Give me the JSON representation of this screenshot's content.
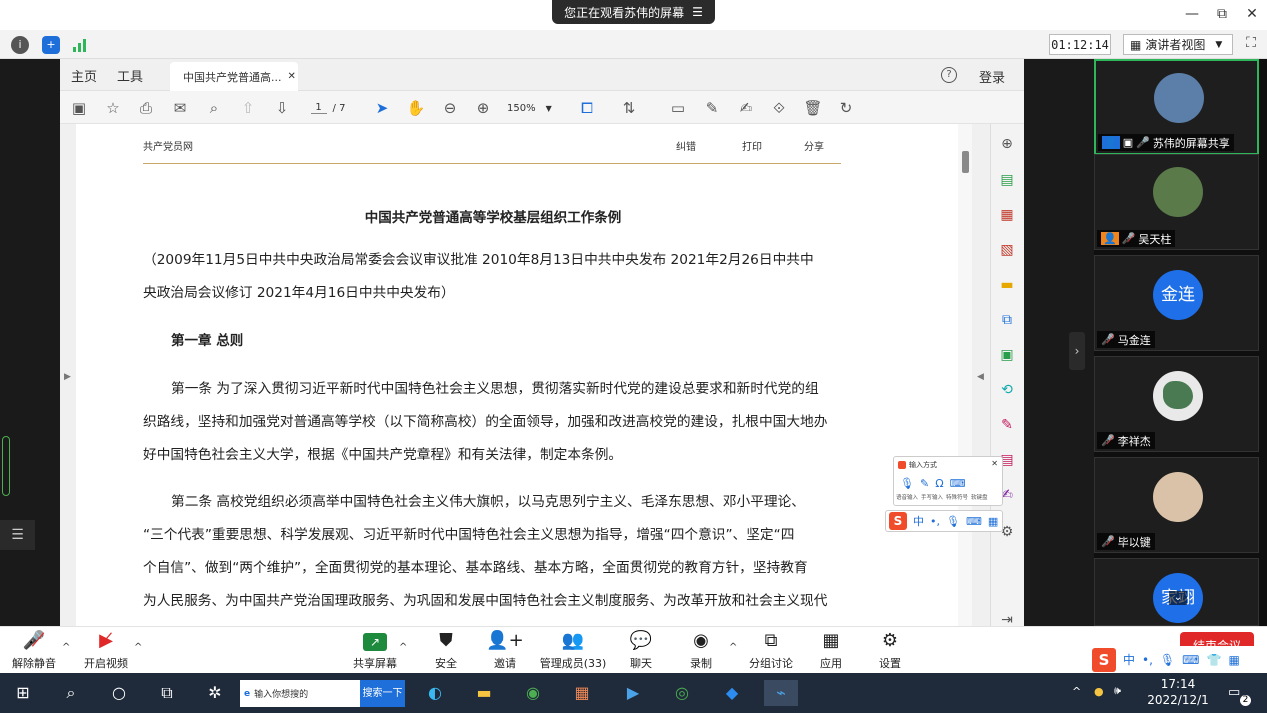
{
  "topbar": {
    "sharing_label": "您正在观看苏伟的屏幕",
    "minimize": "—",
    "restore": "⧉",
    "close": "✕"
  },
  "meeting": {
    "timer": "01:12:14",
    "view_mode": "演讲者视图"
  },
  "pdf": {
    "tab_home": "主页",
    "tab_tools": "工具",
    "doc_tab": "中国共产党普通高...",
    "login": "登录",
    "page_current": "1",
    "page_total": "/ 7",
    "zoom": "150%"
  },
  "doc": {
    "header_site": "共产党员网",
    "header_correct": "纠错",
    "header_print": "打印",
    "header_share": "分享",
    "title": "中国共产党普通高等学校基层组织工作条例",
    "subtitle_line1": "（2009年11月5日中共中央政治局常委会会议审议批准 2010年8月13日中共中央发布 2021年2月26日中共中",
    "subtitle_line2": "央政治局会议修订 2021年4月16日中共中央发布）",
    "chapter": "第一章 总则",
    "art1_line1": "第一条 为了深入贯彻习近平新时代中国特色社会主义思想，贯彻落实新时代党的建设总要求和新时代党的组",
    "art1_line2": "织路线，坚持和加强党对普通高等学校（以下简称高校）的全面领导，加强和改进高校党的建设，扎根中国大地办",
    "art1_line3": "好中国特色社会主义大学，根据《中国共产党章程》和有关法律，制定本条例。",
    "art2_line1": "第二条 高校党组织必须高举中国特色社会主义伟大旗帜，以马克思列宁主义、毛泽东思想、邓小平理论、",
    "art2_line2": "“三个代表”重要思想、科学发展观、习近平新时代中国特色社会主义思想为指导，增强“四个意识”、坚定“四",
    "art2_line3": "个自信”、做到“两个维护”，全面贯彻党的基本理论、基本路线、基本方略，全面贯彻党的教育方针，坚持教育",
    "art2_line4": "为人民服务、为中国共产党治国理政服务、为巩固和发展中国特色社会主义制度服务、为改革开放和社会主义现代"
  },
  "ime": {
    "popup_title": "输入方式",
    "opt1": "语音输入",
    "opt2": "手写输入",
    "opt3": "特殊符号",
    "opt4": "软键盘",
    "mode": "中"
  },
  "participants": [
    {
      "name": "苏伟的屏幕共享"
    },
    {
      "name": "吴天柱"
    },
    {
      "name": "马金连",
      "avatar_text": "金连"
    },
    {
      "name": "李祥杰"
    },
    {
      "name": "毕以键"
    },
    {
      "name": "",
      "avatar_text": "家翊"
    }
  ],
  "controls": {
    "unmute": "解除静音",
    "start_video": "开启视频",
    "share": "共享屏幕",
    "security": "安全",
    "invite": "邀请",
    "manage": "管理成员(33)",
    "chat": "聊天",
    "record": "录制",
    "breakout": "分组讨论",
    "apps": "应用",
    "settings": "设置",
    "end": "结束会议"
  },
  "taskbar": {
    "search_placeholder": "输入你想搜的",
    "search_button": "搜索一下",
    "time": "17:14",
    "date": "2022/12/1",
    "notif_count": "2"
  },
  "colors": {
    "accent": "#1e6fd9",
    "end_red": "#e02828",
    "active_green": "#2fb55a"
  }
}
